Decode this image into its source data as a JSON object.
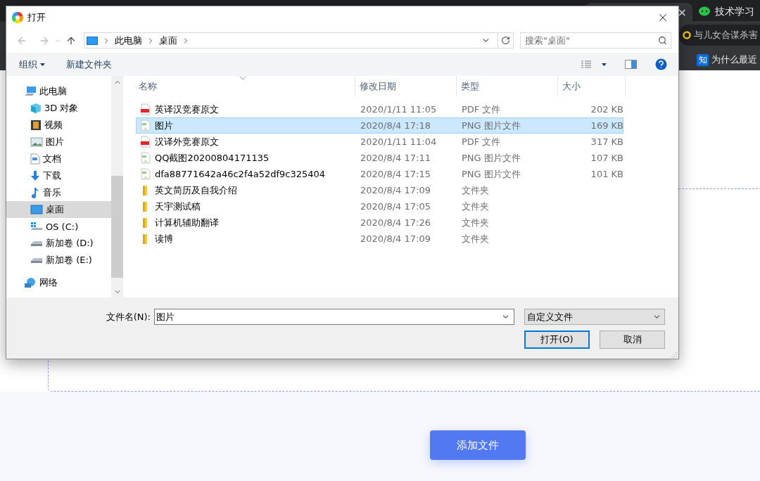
{
  "browser": {
    "tabs": [
      {
        "close": "×",
        "selected": true
      },
      {
        "title": "技术学习",
        "selected": false
      }
    ],
    "omnibox": {
      "text": "与儿女合谋杀害"
    },
    "bookmarks": [
      {
        "badge": "知",
        "label": "为什么最近"
      }
    ]
  },
  "page": {
    "add_button": "添加文件"
  },
  "dialog": {
    "title": "打开",
    "address": {
      "path": [
        "此电脑",
        "桌面"
      ]
    },
    "search": {
      "placeholder": "搜索\"桌面\""
    },
    "toolbar": {
      "organize": "组织",
      "new_folder": "新建文件夹"
    },
    "nav_tree": [
      {
        "label": "此电脑",
        "kind": "pc",
        "selected": false,
        "children": [
          {
            "label": "3D 对象",
            "kind": "cube",
            "selected": false
          },
          {
            "label": "视频",
            "kind": "video",
            "selected": false
          },
          {
            "label": "图片",
            "kind": "pictures",
            "selected": false
          },
          {
            "label": "文档",
            "kind": "documents",
            "selected": false
          },
          {
            "label": "下载",
            "kind": "downloads",
            "selected": false
          },
          {
            "label": "音乐",
            "kind": "music",
            "selected": false
          },
          {
            "label": "桌面",
            "kind": "desktop",
            "selected": true
          },
          {
            "label": "OS (C:)",
            "kind": "system-drive",
            "selected": false
          },
          {
            "label": "新加卷 (D:)",
            "kind": "drive",
            "selected": false
          },
          {
            "label": "新加卷 (E:)",
            "kind": "drive",
            "selected": false
          }
        ]
      },
      {
        "label": "网络",
        "kind": "network",
        "selected": false
      }
    ],
    "columns": [
      "名称",
      "修改日期",
      "类型",
      "大小"
    ],
    "files": [
      {
        "name": "英译汉竞赛原文",
        "date": "2020/1/11 11:05",
        "type": "PDF 文件",
        "size": "202 KB",
        "kind": "pdf",
        "selected": false
      },
      {
        "name": "图片",
        "date": "2020/8/4 17:18",
        "type": "PNG 图片文件",
        "size": "169 KB",
        "kind": "png",
        "selected": true
      },
      {
        "name": "汉译外竞赛原文",
        "date": "2020/1/11 11:04",
        "type": "PDF 文件",
        "size": "317 KB",
        "kind": "pdf",
        "selected": false
      },
      {
        "name": "QQ截图20200804171135",
        "date": "2020/8/4 17:11",
        "type": "PNG 图片文件",
        "size": "107 KB",
        "kind": "png",
        "selected": false
      },
      {
        "name": "dfa88771642a46c2f4a52df9c325404",
        "date": "2020/8/4 17:15",
        "type": "PNG 图片文件",
        "size": "101 KB",
        "kind": "png",
        "selected": false
      },
      {
        "name": "英文简历及自我介绍",
        "date": "2020/8/4 17:09",
        "type": "文件夹",
        "kind": "folder",
        "selected": false
      },
      {
        "name": "天宇测试稿",
        "date": "2020/8/4 17:05",
        "type": "文件夹",
        "kind": "folder",
        "selected": false
      },
      {
        "name": "计算机辅助翻译",
        "date": "2020/8/4 17:26",
        "type": "文件夹",
        "kind": "folder",
        "selected": false
      },
      {
        "name": "读博",
        "date": "2020/8/4 17:09",
        "type": "文件夹",
        "kind": "folder",
        "selected": false
      }
    ],
    "file_name": {
      "label": "文件名(N):",
      "value": "图片"
    },
    "filter": {
      "value": "自定义文件"
    },
    "buttons": [
      {
        "label": "打开(O)",
        "kind": "primary"
      },
      {
        "label": "取消",
        "kind": "normal"
      }
    ]
  }
}
